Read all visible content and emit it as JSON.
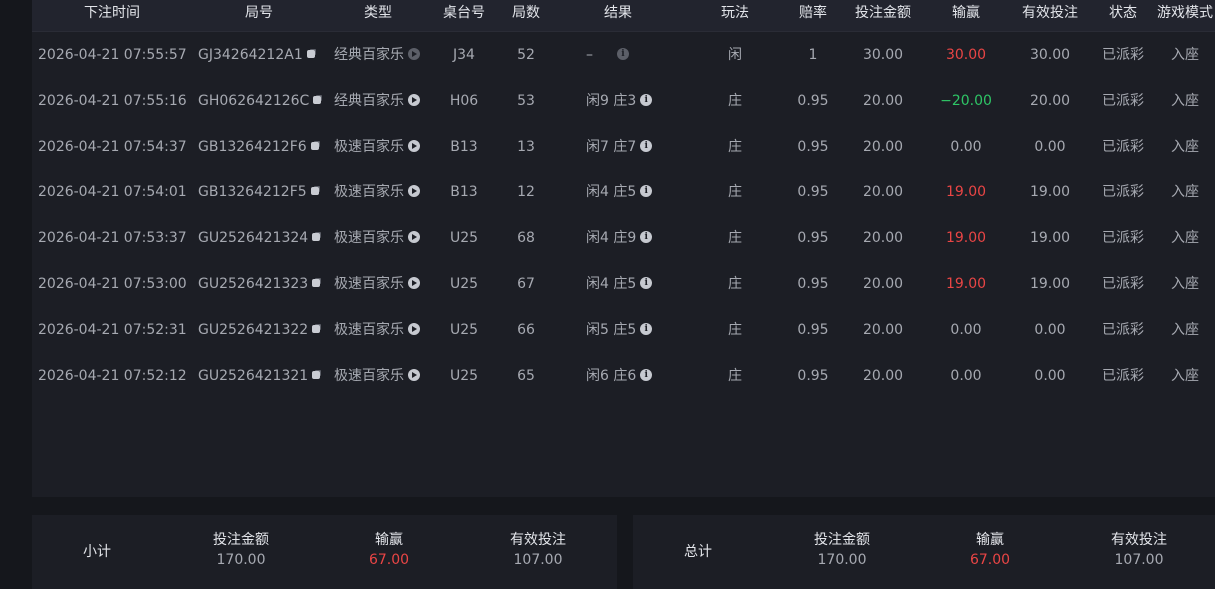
{
  "table": {
    "headers": [
      "下注时间",
      "局号",
      "类型",
      "桌台号",
      "局数",
      "结果",
      "玩法",
      "赔率",
      "投注金额",
      "输赢",
      "有效投注",
      "状态",
      "游戏模式"
    ],
    "rows": [
      {
        "time": "2026-04-21 07:55:57",
        "round_id": "GJ34264212A1",
        "type": "经典百家乐",
        "table": "J34",
        "round": "52",
        "result": "–",
        "play": "闲",
        "odds": "1",
        "bet": "30.00",
        "winloss": "30.00",
        "winloss_color": "red",
        "valid": "30.00",
        "status": "已派彩",
        "mode": "入座",
        "result_icon_dim": true,
        "type_icon_dim": true
      },
      {
        "time": "2026-04-21 07:55:16",
        "round_id": "GH062642126C",
        "type": "经典百家乐",
        "table": "H06",
        "round": "53",
        "result": "闲9 庄3",
        "play": "庄",
        "odds": "0.95",
        "bet": "20.00",
        "winloss": "−20.00",
        "winloss_color": "green",
        "valid": "20.00",
        "status": "已派彩",
        "mode": "入座",
        "result_icon_dim": false,
        "type_icon_dim": false
      },
      {
        "time": "2026-04-21 07:54:37",
        "round_id": "GB13264212F6",
        "type": "极速百家乐",
        "table": "B13",
        "round": "13",
        "result": "闲7 庄7",
        "play": "庄",
        "odds": "0.95",
        "bet": "20.00",
        "winloss": "0.00",
        "winloss_color": "gray",
        "valid": "0.00",
        "status": "已派彩",
        "mode": "入座",
        "result_icon_dim": false,
        "type_icon_dim": false
      },
      {
        "time": "2026-04-21 07:54:01",
        "round_id": "GB13264212F5",
        "type": "极速百家乐",
        "table": "B13",
        "round": "12",
        "result": "闲4 庄5",
        "play": "庄",
        "odds": "0.95",
        "bet": "20.00",
        "winloss": "19.00",
        "winloss_color": "red",
        "valid": "19.00",
        "status": "已派彩",
        "mode": "入座",
        "result_icon_dim": false,
        "type_icon_dim": false
      },
      {
        "time": "2026-04-21 07:53:37",
        "round_id": "GU2526421324",
        "type": "极速百家乐",
        "table": "U25",
        "round": "68",
        "result": "闲4 庄9",
        "play": "庄",
        "odds": "0.95",
        "bet": "20.00",
        "winloss": "19.00",
        "winloss_color": "red",
        "valid": "19.00",
        "status": "已派彩",
        "mode": "入座",
        "result_icon_dim": false,
        "type_icon_dim": false
      },
      {
        "time": "2026-04-21 07:53:00",
        "round_id": "GU2526421323",
        "type": "极速百家乐",
        "table": "U25",
        "round": "67",
        "result": "闲4 庄5",
        "play": "庄",
        "odds": "0.95",
        "bet": "20.00",
        "winloss": "19.00",
        "winloss_color": "red",
        "valid": "19.00",
        "status": "已派彩",
        "mode": "入座",
        "result_icon_dim": false,
        "type_icon_dim": false
      },
      {
        "time": "2026-04-21 07:52:31",
        "round_id": "GU2526421322",
        "type": "极速百家乐",
        "table": "U25",
        "round": "66",
        "result": "闲5 庄5",
        "play": "庄",
        "odds": "0.95",
        "bet": "20.00",
        "winloss": "0.00",
        "winloss_color": "gray",
        "valid": "0.00",
        "status": "已派彩",
        "mode": "入座",
        "result_icon_dim": false,
        "type_icon_dim": false
      },
      {
        "time": "2026-04-21 07:52:12",
        "round_id": "GU2526421321",
        "type": "极速百家乐",
        "table": "U25",
        "round": "65",
        "result": "闲6 庄6",
        "play": "庄",
        "odds": "0.95",
        "bet": "20.00",
        "winloss": "0.00",
        "winloss_color": "gray",
        "valid": "0.00",
        "status": "已派彩",
        "mode": "入座",
        "result_icon_dim": false,
        "type_icon_dim": false
      }
    ]
  },
  "subtotal": {
    "title": "小计",
    "bet_label": "投注金额",
    "bet_value": "170.00",
    "winloss_label": "输赢",
    "winloss_value": "67.00",
    "valid_label": "有效投注",
    "valid_value": "107.00"
  },
  "total": {
    "title": "总计",
    "bet_label": "投注金额",
    "bet_value": "170.00",
    "winloss_label": "输赢",
    "winloss_value": "67.00",
    "valid_label": "有效投注",
    "valid_value": "107.00"
  },
  "icons": {
    "copy": "copy-icon",
    "play": "play-circle-icon",
    "info": "info-icon"
  },
  "colors": {
    "win": "#e94545",
    "loss": "#2ec566",
    "neutral": "#a6a9b1",
    "header_bg": "#22242e",
    "panel_bg": "#1c1e25",
    "page_bg": "#15171c"
  }
}
